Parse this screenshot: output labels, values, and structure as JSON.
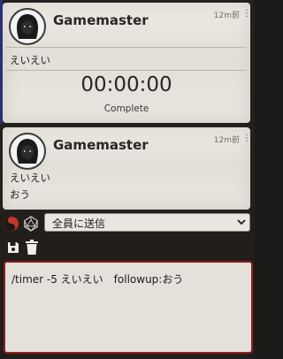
{
  "messages": [
    {
      "sender": "Gamemaster",
      "time": "12m前",
      "menu_glyph": "⋮",
      "text": "えいえい",
      "timer": {
        "value": "00:00:00",
        "status": "Complete"
      }
    },
    {
      "sender": "Gamemaster",
      "time": "12m前",
      "menu_glyph": "⋮",
      "lines": [
        "えいえい",
        "おう"
      ]
    }
  ],
  "controls": {
    "roll_mode_select": {
      "selected": "全員に送信"
    },
    "icons": [
      "yin-yang-icon",
      "d20-dice-icon",
      "save-icon",
      "trash-icon",
      "chevron-down-icon"
    ]
  },
  "chat_input": {
    "value": "/timer -5 えいえい　followup:おう"
  },
  "colors": {
    "card_bg": "#e8e5df",
    "input_border": "#8b2020",
    "sidebar_accent": "#2b2f78",
    "icon_red": "#c0392b"
  }
}
